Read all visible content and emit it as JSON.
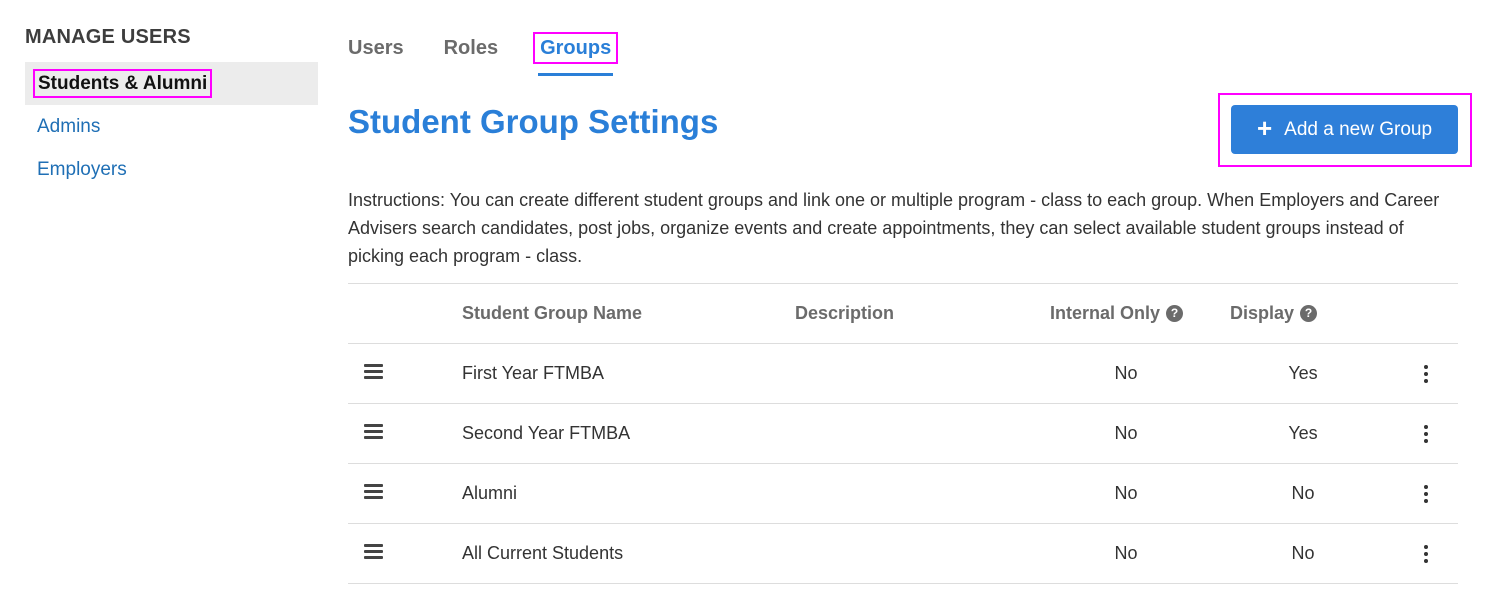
{
  "sidebar": {
    "heading": "MANAGE USERS",
    "items": [
      {
        "label": "Students & Alumni",
        "active": true
      },
      {
        "label": "Admins",
        "active": false
      },
      {
        "label": "Employers",
        "active": false
      }
    ]
  },
  "tabs": [
    {
      "label": "Users",
      "active": false
    },
    {
      "label": "Roles",
      "active": false
    },
    {
      "label": "Groups",
      "active": true
    }
  ],
  "page": {
    "title": "Student Group Settings",
    "add_button_label": "Add a new Group",
    "add_button_icon": "plus-icon",
    "instructions": "Instructions: You can create different student groups and link one or multiple program - class to each group. When Employers and Career Advisers search candidates, post jobs, organize events and create appointments, they can select available student groups instead of picking each program - class."
  },
  "table": {
    "columns": {
      "name": "Student Group Name",
      "description": "Description",
      "internal_only": "Internal Only",
      "display": "Display"
    },
    "help_icon_glyph": "?",
    "rows": [
      {
        "name": "First Year FTMBA",
        "description": "",
        "internal_only": "No",
        "display": "Yes"
      },
      {
        "name": "Second Year FTMBA",
        "description": "",
        "internal_only": "No",
        "display": "Yes"
      },
      {
        "name": "Alumni",
        "description": "",
        "internal_only": "No",
        "display": "No"
      },
      {
        "name": "All Current Students",
        "description": "",
        "internal_only": "No",
        "display": "No"
      }
    ]
  },
  "colors": {
    "accent": "#2a7fd8",
    "button": "#2e7fd9",
    "link": "#1f6fb5",
    "highlight": "#ff00ff"
  }
}
